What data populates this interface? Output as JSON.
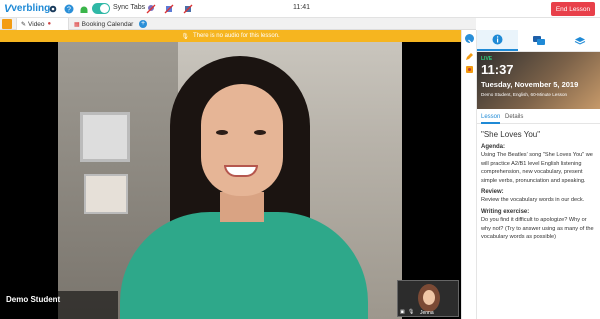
{
  "topbar": {
    "logo": "verbling",
    "sync_tabs_label": "Sync Tabs",
    "sync_tabs_on": true,
    "clock": "11:41",
    "end_lesson_label": "End Lesson",
    "icons": [
      "gear-icon",
      "help-icon",
      "android-icon",
      "toggle",
      "hide-icon-1",
      "hide-icon-2",
      "hide-icon-3"
    ]
  },
  "tabs": [
    {
      "label": "Video",
      "active": true
    },
    {
      "label": "Booking Calendar",
      "active": false
    }
  ],
  "banner": {
    "text": "There is no audio for this lesson."
  },
  "video": {
    "student_name": "Demo Student",
    "teacher_name": "Jenna"
  },
  "panel": {
    "hero": {
      "live": "LIVE",
      "time": "11:37",
      "date": "Tuesday, November 5, 2019",
      "subtitle": "Demo Student, English, 60-Minute Lesson"
    },
    "tabs": [
      "Lesson",
      "Details"
    ],
    "lesson": {
      "title": "\"She Loves You\"",
      "agenda_heading": "Agenda:",
      "agenda_text": "Using The Beatles' song \"She Loves You\" we will practice A2/B1 level English listening comprehension, new vocabulary, present simple verbs, pronunciation and speaking.",
      "review_heading": "Review:",
      "review_text": "Review the vocabulary words in our deck.",
      "writing_heading": "Writing exercise:",
      "writing_text": "Do you find it difficult to apologize? Why or why not? (Try to answer using as many of the vocabulary words as possible)"
    }
  },
  "colors": {
    "brand": "#1f8ad6",
    "end_button": "#e8404a",
    "banner": "#f6b51f",
    "toggle": "#2fb8a6",
    "live": "#2fd07f"
  }
}
